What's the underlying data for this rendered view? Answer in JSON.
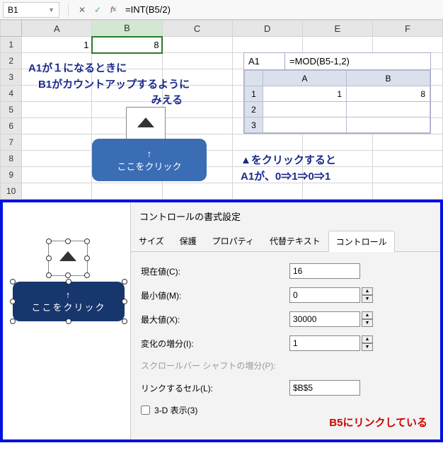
{
  "formula_bar": {
    "name_box": "B1",
    "formula": "=INT(B5/2)"
  },
  "grid": {
    "cols": [
      "A",
      "B",
      "C",
      "D",
      "E",
      "F"
    ],
    "rows": [
      1,
      2,
      3,
      4,
      5,
      6,
      7,
      8,
      9,
      10
    ],
    "A1": "1",
    "B1": "8"
  },
  "annotations": {
    "note1_l1": "A1が１になるときに",
    "note1_l2": "B1がカウントアップするように",
    "note1_l3": "みえる",
    "note2_l1": "▲をクリックすると",
    "note2_l2": "A1が、0⇒1⇒0⇒1"
  },
  "callout": {
    "arrow": "↑",
    "text": "ここをクリック"
  },
  "inset": {
    "name_box": "A1",
    "formula": "=MOD(B5-1,2)",
    "cols": [
      "A",
      "B"
    ],
    "rows": [
      1,
      2,
      3
    ],
    "A1": "1",
    "B1": "8"
  },
  "dialog": {
    "title": "コントロールの書式設定",
    "tabs": {
      "size": "サイズ",
      "protect": "保護",
      "property": "プロパティ",
      "alttext": "代替テキスト",
      "control": "コントロール"
    },
    "fields": {
      "current_label": "現在値(C):",
      "current_value": "16",
      "min_label": "最小値(M):",
      "min_value": "0",
      "max_label": "最大値(X):",
      "max_value": "30000",
      "step_label": "変化の増分(I):",
      "step_value": "1",
      "scroll_label": "スクロールバー シャフトの増分(P):",
      "link_label": "リンクするセル(L):",
      "link_value": "$B$5",
      "threed_label": "3-D 表示(3)"
    }
  },
  "red_note": "B5にリンクしている"
}
